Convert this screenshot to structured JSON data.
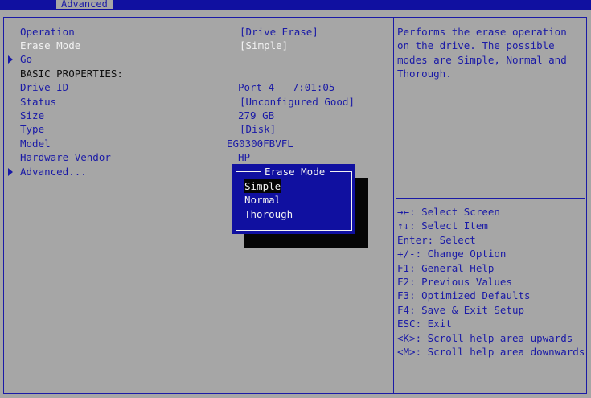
{
  "header": {
    "active_tab": "Advanced"
  },
  "settings": {
    "rows": [
      {
        "label": "Operation",
        "value": "[Drive Erase]",
        "highlight": false
      },
      {
        "label": "Erase Mode",
        "value": "[Simple]",
        "highlight": true
      },
      {
        "label": "Go",
        "value": "",
        "submenu": true
      },
      {
        "label": "BASIC PROPERTIES:",
        "value": "",
        "heading": true
      },
      {
        "label": "Drive ID",
        "value": "Port 4 - 7:01:05"
      },
      {
        "label": "Status",
        "value": "[Unconfigured Good]"
      },
      {
        "label": "Size",
        "value": "279 GB"
      },
      {
        "label": "Type",
        "value": "[Disk]"
      },
      {
        "label": "Model",
        "value": "EG0300FBVFL"
      },
      {
        "label": "Hardware Vendor",
        "value": "HP"
      },
      {
        "label": "Advanced...",
        "value": "",
        "submenu": true
      }
    ]
  },
  "help": {
    "text": "Performs the erase operation on the drive. The possible modes are Simple, Normal and Thorough."
  },
  "keys": [
    "→←: Select Screen",
    "↑↓: Select Item",
    "Enter: Select",
    "+/-: Change Option",
    "F1: General Help",
    "F2: Previous Values",
    "F3: Optimized Defaults",
    "F4: Save & Exit Setup",
    "ESC: Exit",
    "<K>: Scroll help area upwards",
    "<M>: Scroll help area downwards"
  ],
  "popup": {
    "title": "Erase Mode",
    "options": [
      "Simple",
      "Normal",
      "Thorough"
    ],
    "selected": "Simple"
  },
  "colors": {
    "background": "#a6a6a6",
    "blue": "#1010a0",
    "text_blue": "#1a1aa6",
    "white": "#f2f2f2"
  }
}
